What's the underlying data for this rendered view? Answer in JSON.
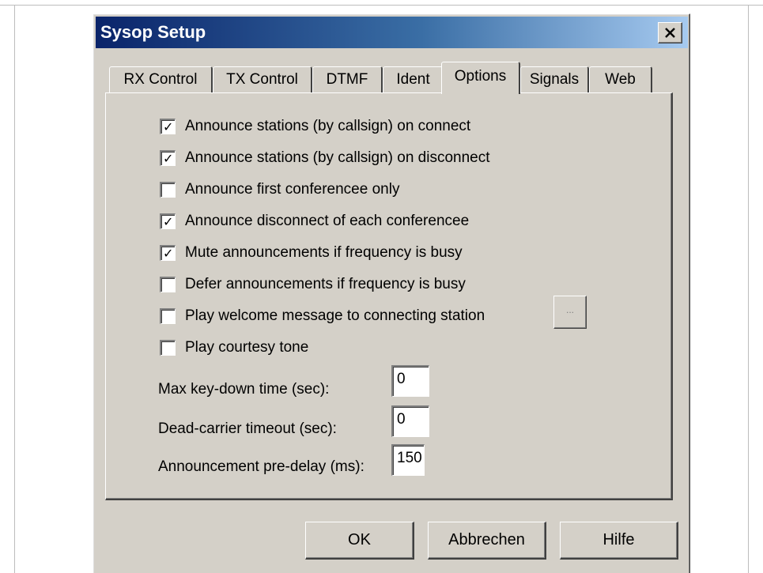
{
  "window": {
    "title": "Sysop Setup",
    "close_glyph": "×"
  },
  "tabs": [
    {
      "label": "RX Control",
      "active": false
    },
    {
      "label": "TX Control",
      "active": false
    },
    {
      "label": "DTMF",
      "active": false
    },
    {
      "label": "Ident",
      "active": false
    },
    {
      "label": "Options",
      "active": true
    },
    {
      "label": "Signals",
      "active": false
    },
    {
      "label": "Web",
      "active": false
    }
  ],
  "options": {
    "checkboxes": [
      {
        "label": "Announce stations (by callsign) on connect",
        "checked": true
      },
      {
        "label": "Announce stations (by callsign) on disconnect",
        "checked": true
      },
      {
        "label": "Announce first conferencee only",
        "checked": false
      },
      {
        "label": "Announce disconnect of each conferencee",
        "checked": true
      },
      {
        "label": "Mute announcements if frequency is busy",
        "checked": true
      },
      {
        "label": "Defer announcements if frequency is busy",
        "checked": false
      },
      {
        "label": "Play welcome message to connecting station",
        "checked": false
      },
      {
        "label": "Play courtesy tone",
        "checked": false
      }
    ],
    "browse_button_label": "...",
    "fields": [
      {
        "label": "Max key-down time (sec):",
        "value": "0"
      },
      {
        "label": "Dead-carrier timeout (sec):",
        "value": "0"
      },
      {
        "label": "Announcement pre-delay (ms):",
        "value": "150"
      }
    ]
  },
  "buttons": {
    "ok": "OK",
    "cancel": "Abbrechen",
    "help": "Hilfe"
  },
  "colors": {
    "titlebar_start": "#0a246a",
    "titlebar_end": "#a6caf0",
    "face": "#d4d0c8"
  }
}
